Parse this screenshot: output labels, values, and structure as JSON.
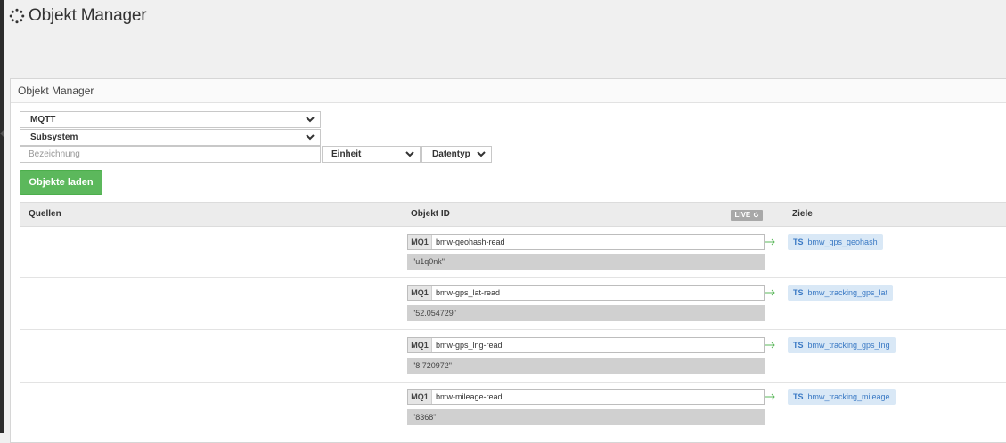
{
  "page": {
    "title": "Objekt Manager"
  },
  "panel": {
    "heading": "Objekt Manager"
  },
  "filters": {
    "adapter": "MQTT",
    "subsystem": "Subsystem",
    "bezeichnung_placeholder": "Bezeichnung",
    "einheit": "Einheit",
    "datentyp": "Datentyp"
  },
  "load_button": "Objekte laden",
  "table": {
    "col_sources": "Quellen",
    "col_object_id": "Objekt ID",
    "live_badge": "LIVE",
    "col_targets": "Ziele"
  },
  "rows": [
    {
      "source_tag": "MQ1",
      "object_id": "bmw-geohash-read",
      "value": "\"u1q0nk\"",
      "target_tag": "TS",
      "target": "bmw_gps_geohash"
    },
    {
      "source_tag": "MQ1",
      "object_id": "bmw-gps_lat-read",
      "value": "\"52.054729\"",
      "target_tag": "TS",
      "target": "bmw_tracking_gps_lat"
    },
    {
      "source_tag": "MQ1",
      "object_id": "bmw-gps_lng-read",
      "value": "\"8.720972\"",
      "target_tag": "TS",
      "target": "bmw_tracking_gps_lng"
    },
    {
      "source_tag": "MQ1",
      "object_id": "bmw-mileage-read",
      "value": "\"8368\"",
      "target_tag": "TS",
      "target": "bmw_tracking_mileage"
    }
  ],
  "colors": {
    "button_green": "#5cb85c",
    "target_bg": "#d9e8f6",
    "target_text": "#3a79c4",
    "value_bg": "#d0d0d0"
  }
}
